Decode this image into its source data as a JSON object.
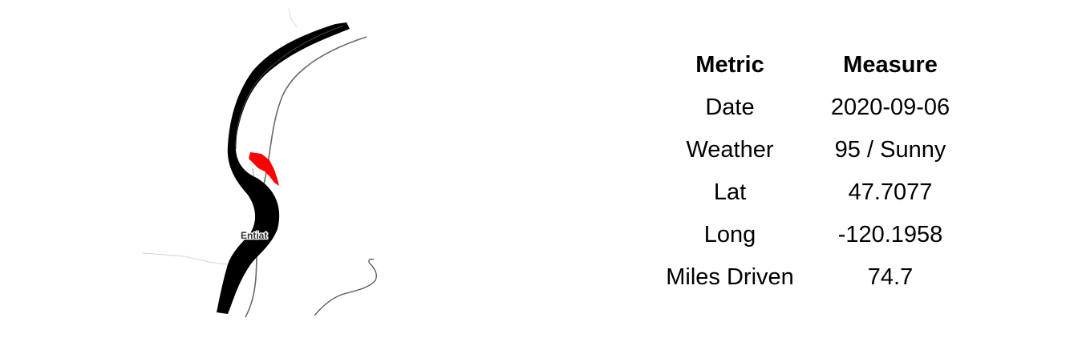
{
  "map": {
    "place_label": "Entiat",
    "river_color": "#000000",
    "highlight_color": "#ff0000",
    "road_color": "#666666",
    "faint_road_color": "#cccccc"
  },
  "table": {
    "headers": {
      "metric": "Metric",
      "measure": "Measure"
    },
    "rows": [
      {
        "metric": "Date",
        "measure": "2020-09-06"
      },
      {
        "metric": "Weather",
        "measure": "95 / Sunny"
      },
      {
        "metric": "Lat",
        "measure": "47.7077"
      },
      {
        "metric": "Long",
        "measure": "-120.1958"
      },
      {
        "metric": "Miles Driven",
        "measure": "74.7"
      }
    ]
  }
}
